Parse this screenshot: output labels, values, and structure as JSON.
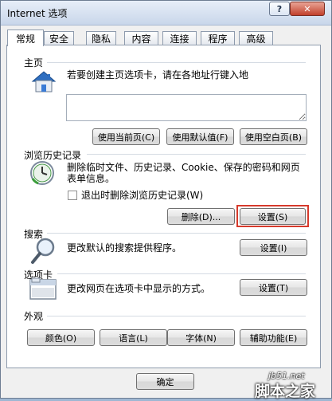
{
  "window": {
    "title": "Internet 选项",
    "help_label": "?",
    "close_label": "✕"
  },
  "tabs": [
    {
      "label": "常规"
    },
    {
      "label": "安全"
    },
    {
      "label": "隐私"
    },
    {
      "label": "内容"
    },
    {
      "label": "连接"
    },
    {
      "label": "程序"
    },
    {
      "label": "高级"
    }
  ],
  "homepage": {
    "section": "主页",
    "desc": "若要创建主页选项卡，请在各地址行键入地",
    "value": "",
    "btn_current": "使用当前页(C)",
    "btn_default": "使用默认值(F)",
    "btn_blank": "使用空白页(B)"
  },
  "history": {
    "section": "浏览历史记录",
    "desc_line1": "删除临时文件、历史记录、Cookie、保存的密码和网页",
    "desc_line2": "表单信息。",
    "checkbox_label": "退出时删除浏览历史记录(W)",
    "checked": false,
    "btn_delete": "删除(D)...",
    "btn_settings": "设置(S)"
  },
  "search": {
    "section": "搜索",
    "desc": "更改默认的搜索提供程序。",
    "btn_settings": "设置(I)"
  },
  "tabs_section": {
    "section": "选项卡",
    "desc": "更改网页在选项卡中显示的方式。",
    "btn_settings": "设置(T)"
  },
  "appearance": {
    "section": "外观",
    "btn_colors": "颜色(O)",
    "btn_languages": "语言(L)",
    "btn_fonts": "字体(N)",
    "btn_accessibility": "辅助功能(E)"
  },
  "footer": {
    "btn_ok": "确定"
  },
  "watermark": {
    "site": "jb51.net",
    "name": "脚本之家"
  },
  "colors": {
    "highlight": "#d63a2c",
    "close_button": "#c1402c"
  }
}
